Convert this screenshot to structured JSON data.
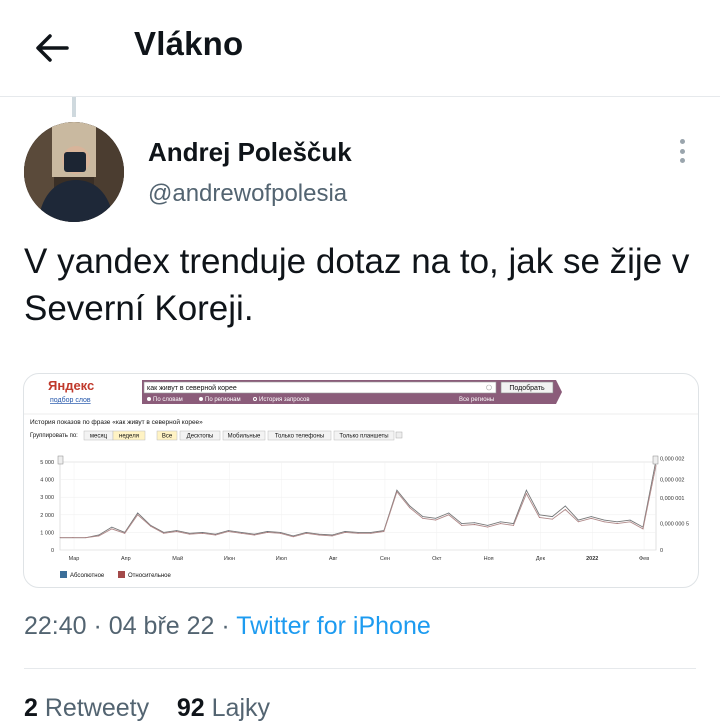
{
  "header": {
    "title": "Vlákno"
  },
  "author": {
    "name": "Andrej Poleščuk",
    "handle": "@andrewofpolesia"
  },
  "tweet": {
    "text": "V yandex trenduje dotaz na to, jak se žije v Severní Koreji."
  },
  "media": {
    "logo": "Яндекс",
    "logo_sub": "подбор слов",
    "query": "как живут в северной корее",
    "search_button": "Подобрать",
    "radio_words": "По словам",
    "radio_regions": "По регионам",
    "radio_history": "История запросов",
    "all_regions": "Все регионы",
    "history_title": "История показов по фразе «как живут в северной корее»",
    "group_label": "Группировать по:",
    "group_month": "месяц",
    "group_week": "неделя",
    "filters": [
      "Все",
      "Десктопы",
      "Мобильные",
      "Только телефоны",
      "Только планшеты"
    ],
    "legend_absolute": "Абсолютное",
    "legend_relative": "Относительное",
    "y_ticks_left": [
      "5 000",
      "4 000",
      "3 000",
      "2 000",
      "1 000",
      "0"
    ],
    "y_ticks_right": [
      "0,000 002",
      "0,000 002",
      "0,000 001",
      "0,000 000 5",
      "0"
    ],
    "x_ticks": [
      "Мар",
      "Апр",
      "Май",
      "Июн",
      "Июл",
      "Авг",
      "Сен",
      "Окт",
      "Ноя",
      "Дек",
      "2022",
      "Фев"
    ],
    "colors": {
      "absolute": "#3b6e99",
      "relative": "#a34a4a",
      "brand_bar": "#8b5c7a"
    }
  },
  "chart_data": {
    "type": "line",
    "x": [
      "Мар",
      "",
      "",
      "",
      "Апр",
      "",
      "",
      "",
      "Май",
      "",
      "",
      "",
      "Июн",
      "",
      "",
      "",
      "Июл",
      "",
      "",
      "",
      "Авг",
      "",
      "",
      "",
      "Сен",
      "",
      "",
      "",
      "Окт",
      "",
      "",
      "",
      "Ноя",
      "",
      "",
      "",
      "Дек",
      "",
      "",
      "",
      "2022",
      "",
      "",
      "",
      "Фев",
      "",
      ""
    ],
    "series": [
      {
        "name": "Абсолютное",
        "values": [
          700,
          700,
          700,
          850,
          1300,
          1000,
          2100,
          1400,
          1000,
          1100,
          950,
          1000,
          900,
          1100,
          1000,
          900,
          1050,
          1000,
          800,
          1000,
          900,
          850,
          1050,
          1000,
          1000,
          1100,
          3400,
          2500,
          1900,
          1800,
          2100,
          1500,
          1550,
          1400,
          1600,
          1500,
          3400,
          2000,
          1900,
          2500,
          1700,
          1900,
          1700,
          1600,
          1700,
          1300,
          5100
        ]
      },
      {
        "name": "Относительное",
        "values": [
          700,
          700,
          700,
          800,
          1200,
          950,
          2000,
          1350,
          950,
          1050,
          900,
          950,
          850,
          1050,
          950,
          850,
          1000,
          950,
          750,
          950,
          850,
          800,
          1000,
          950,
          950,
          1050,
          3300,
          2400,
          1800,
          1700,
          2000,
          1400,
          1450,
          1300,
          1500,
          1400,
          3200,
          1850,
          1750,
          2300,
          1600,
          1800,
          1600,
          1500,
          1600,
          1200,
          4800
        ]
      }
    ],
    "ylim": [
      0,
      5000
    ],
    "grid": true,
    "legend": "bottom-left"
  },
  "timestamp": {
    "time": "22:40",
    "date": "04 bře 22",
    "source": "Twitter for iPhone",
    "sep": "·"
  },
  "stats": {
    "retweets_count": "2",
    "retweets_label": "Retweety",
    "likes_count": "92",
    "likes_label": "Lajky"
  }
}
